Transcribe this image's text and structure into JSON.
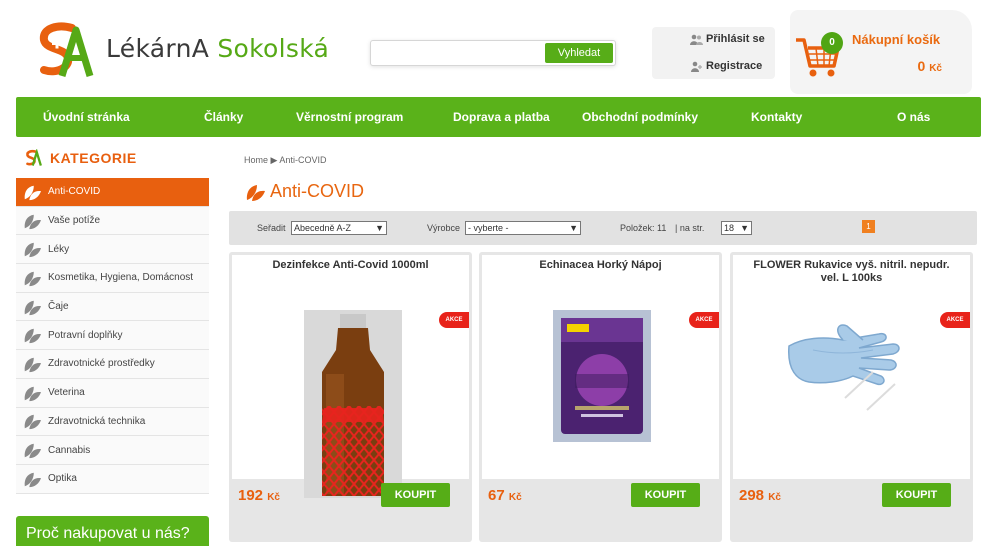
{
  "header": {
    "logo_text_pre": "LékárnA",
    "logo_text_post": " Sokolská",
    "search": {
      "value": "",
      "button_label": "Vyhledat"
    },
    "login_label": "Přihlásit se",
    "register_label": "Registrace",
    "cart": {
      "title": "Nákupní košík",
      "count": "0",
      "total": "0",
      "currency": "Kč"
    }
  },
  "nav": {
    "items": [
      "Úvodní stránka",
      "Články",
      "Věrnostní program",
      "Doprava a platba",
      "Obchodní podmínky",
      "Kontakty",
      "O nás"
    ]
  },
  "sidebar": {
    "title": "KATEGORIE",
    "items": [
      {
        "label": "Anti-COVID",
        "active": true
      },
      {
        "label": "Vaše potíže"
      },
      {
        "label": "Léky"
      },
      {
        "label": "Kosmetika, Hygiena, Domácnost"
      },
      {
        "label": "Čaje"
      },
      {
        "label": "Potravní doplňky"
      },
      {
        "label": "Zdravotnické prostředky"
      },
      {
        "label": "Veterina"
      },
      {
        "label": "Zdravotnická technika"
      },
      {
        "label": "Cannabis"
      },
      {
        "label": "Optika"
      }
    ],
    "why_label": "Proč nakupovat u nás?"
  },
  "main": {
    "breadcrumb": "Home ▶ Anti-COVID",
    "title": "Anti-COVID",
    "toolbar": {
      "sort_label": "Seřadit",
      "sort_value": "Abecedně A-Z",
      "producer_label": "Výrobce",
      "producer_value": "- vyberte -",
      "count_text": "Položek: 11",
      "per_page_label": "| na str.",
      "per_page_value": "18",
      "current_page": "1"
    },
    "products": [
      {
        "name": "Dezinfekce Anti-Covid 1000ml",
        "badge": "AKCE",
        "price": "192",
        "currency": "Kč",
        "buy_label": "KOUPIT",
        "image": "red-net-bottle"
      },
      {
        "name": "Echinacea Horký Nápoj",
        "badge": "AKCE",
        "price": "67",
        "currency": "Kč",
        "buy_label": "KOUPIT",
        "image": "purple-sachet"
      },
      {
        "name": "FLOWER Rukavice vyš. nitril. nepudr. vel. L 100ks",
        "badge": "AKCE",
        "price": "298",
        "currency": "Kč",
        "buy_label": "KOUPIT",
        "image": "blue-glove"
      }
    ]
  },
  "colors": {
    "green": "#5ab21a",
    "orange": "#e8600f",
    "badge_red": "#e8231a"
  }
}
